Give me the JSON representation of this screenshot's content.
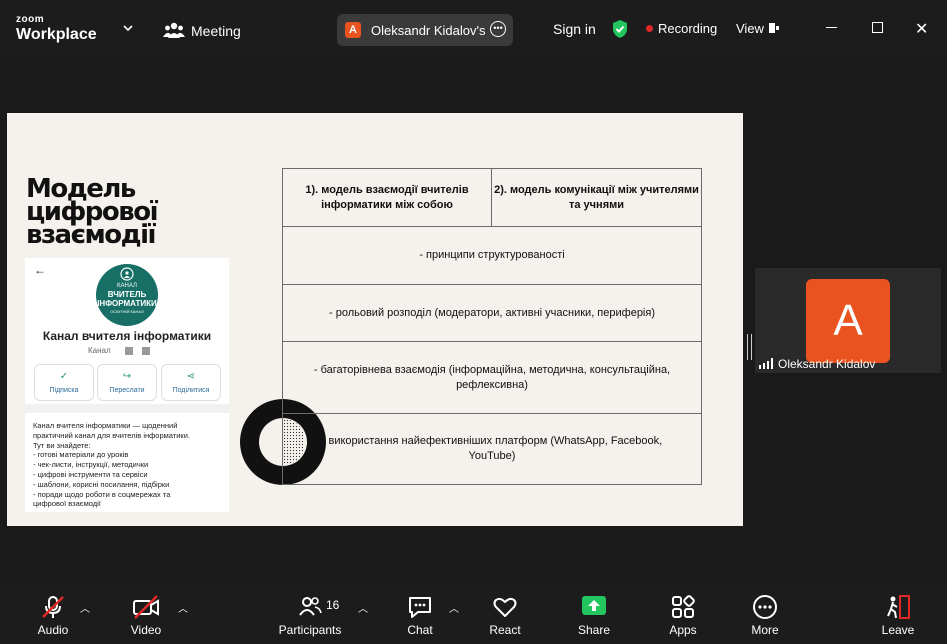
{
  "app": {
    "logo_top": "zoom",
    "logo_main": "Workplace"
  },
  "header": {
    "meeting_label": "Meeting",
    "tab_avatar": "A",
    "tab_label": "Oleksandr Kidalov's s",
    "signin": "Sign in",
    "recording": "Recording",
    "view": "View"
  },
  "colors": {
    "accent": "#e8531f",
    "share_green": "#22c55e",
    "rec_red": "#e02828",
    "teal": "#186f66"
  },
  "slide": {
    "title_lines": [
      "Модель",
      "цифрової",
      "взаємодії"
    ],
    "phone": {
      "channel_logo_small": "КАНАЛ",
      "channel_logo_main": "ВЧИТЕЛЬ ІНФОРМАТИКИ",
      "channel_logo_sub": "ОСВІТНІЙ КАНАЛ",
      "channel_name": "Канал вчителя інформатики",
      "channel_type": "Канал",
      "buttons": [
        {
          "icon": "✓",
          "label": "Підписка"
        },
        {
          "icon": "↪",
          "label": "Переслати"
        },
        {
          "icon": "⋖",
          "label": "Поділитися"
        }
      ],
      "description": [
        "Канал вчителя інформатики — щоденний",
        "практичний канал для вчителів інформатики.",
        "Тут ви знайдете:",
        "- готові матеріали до уроків",
        "- чек-листи, інструкції, методички",
        "- цифрові інструменти та сервіси",
        "- шаблони, корисні посилання, підбірки",
        "- поради щодо роботи в соцмережах та",
        "цифрової взаємодії"
      ]
    },
    "table": {
      "header_left": "1). модель взаємодії вчителів інформатики між собою",
      "header_right": "2). модель комунікації між учителями та учнями",
      "rows": [
        "- принципи структурованості",
        "- рольовий розподіл (модератори, активні учасники, периферія)",
        "- багаторівнева взаємодія (інформаційна, методична, консультаційна, рефлексивна)",
        "- використання найефективніших платформ (WhatsApp, Facebook, YouTube)"
      ]
    }
  },
  "participant_tile": {
    "avatar": "A",
    "name": "Oleksandr Kidalov"
  },
  "toolbar": {
    "audio": "Audio",
    "video": "Video",
    "participants": "Participants",
    "participants_count": "16",
    "chat": "Chat",
    "react": "React",
    "share": "Share",
    "apps": "Apps",
    "more": "More",
    "leave": "Leave"
  }
}
